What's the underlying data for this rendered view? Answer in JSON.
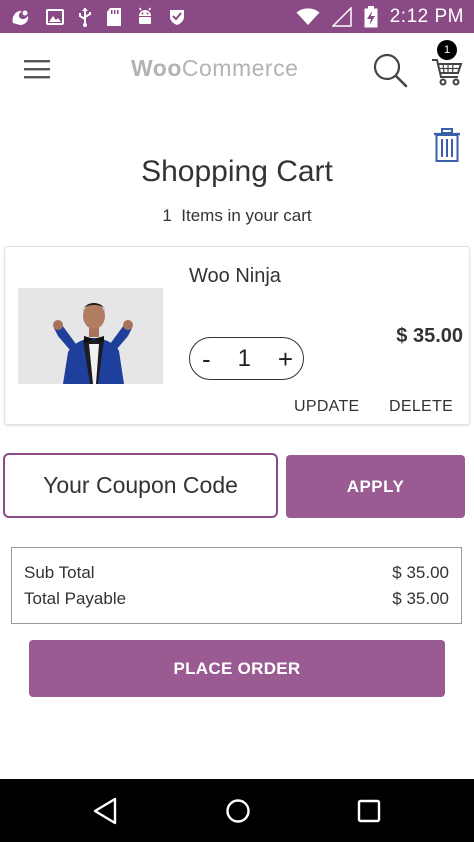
{
  "status_bar": {
    "time": "2:12 PM",
    "icons": [
      "uc-browser-icon",
      "image-icon",
      "usb-icon",
      "sd-card-icon",
      "android-icon",
      "shield-check-icon",
      "wifi-icon",
      "signal-icon",
      "battery-charging-icon"
    ]
  },
  "header": {
    "logo_bold": "Woo",
    "logo_light": "Commerce",
    "cart_count": "1",
    "icons": [
      "menu-icon",
      "search-icon",
      "cart-icon"
    ]
  },
  "page": {
    "title": "Shopping Cart",
    "items_count": "1",
    "items_label": "Items in your cart"
  },
  "cart_item": {
    "name": "Woo Ninja",
    "quantity": "1",
    "minus_label": "-",
    "plus_label": "+",
    "price": "$ 35.00",
    "update_label": "UPDATE",
    "delete_label": "DELETE"
  },
  "coupon": {
    "placeholder": "Your Coupon Code",
    "apply_label": "APPLY"
  },
  "totals": {
    "sub_total_label": "Sub Total",
    "sub_total_value": "$ 35.00",
    "payable_label": "Total Payable",
    "payable_value": "$ 35.00"
  },
  "place_order_label": "PLACE ORDER",
  "colors": {
    "status_bar": "#8a4a86",
    "accent": "#9a5b93",
    "nav_bar": "#000000"
  }
}
